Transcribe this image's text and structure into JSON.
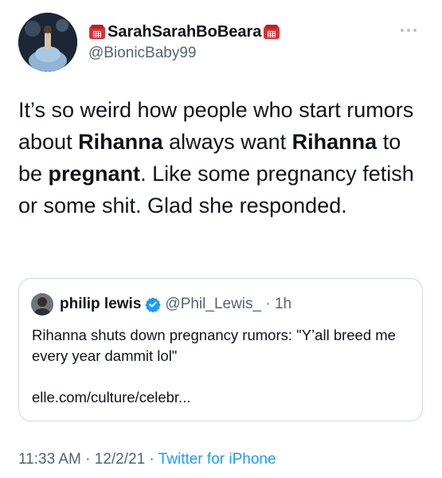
{
  "author": {
    "display_name": "SarahSarahBoBeara",
    "handle": "@BionicBaby99"
  },
  "tweet": {
    "segments": [
      {
        "text": "It’s so weird how people who start rumors about ",
        "bold": false
      },
      {
        "text": "Rihanna",
        "bold": true
      },
      {
        "text": " always want ",
        "bold": false
      },
      {
        "text": "Rihanna",
        "bold": true
      },
      {
        "text": " to be ",
        "bold": false
      },
      {
        "text": "pregnant",
        "bold": true
      },
      {
        "text": ". Like some pregnancy fetish or some shit. Glad she responded.",
        "bold": false
      }
    ]
  },
  "quote": {
    "name": "philip lewis",
    "handle_time": "@Phil_Lewis_ · 1h",
    "body": "Rihanna shuts down pregnancy rumors: \"Y’all breed me every year dammit lol\"",
    "link": "elle.com/culture/celebr..."
  },
  "meta": {
    "timestamp": "11:33 AM · 12/2/21 · ",
    "source": "Twitter for iPhone"
  },
  "icons": {
    "display_name_decoration": "telephone-emoji",
    "verified": "verified-badge-icon",
    "more": "more-options-icon"
  },
  "colors": {
    "link": "#1d9bf0",
    "secondary_text": "#536471",
    "border": "#cfd9de"
  }
}
